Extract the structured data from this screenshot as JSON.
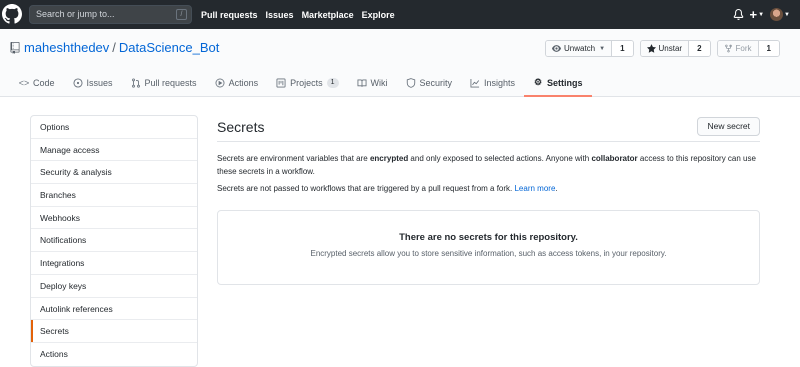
{
  "header": {
    "search_placeholder": "Search or jump to...",
    "search_key": "/",
    "nav": [
      "Pull requests",
      "Issues",
      "Marketplace",
      "Explore"
    ],
    "plus": "+"
  },
  "repo": {
    "owner": "maheshthedev",
    "separator": "/",
    "name": "DataScience_Bot",
    "actions": {
      "watch": {
        "label": "Unwatch",
        "count": "1"
      },
      "star": {
        "label": "Unstar",
        "count": "2"
      },
      "fork": {
        "label": "Fork",
        "count": "1"
      }
    },
    "tabs": [
      {
        "label": "Code",
        "icon": "code-icon"
      },
      {
        "label": "Issues",
        "icon": "issue-icon"
      },
      {
        "label": "Pull requests",
        "icon": "pull-request-icon"
      },
      {
        "label": "Actions",
        "icon": "play-icon"
      },
      {
        "label": "Projects",
        "icon": "project-icon",
        "badge": "1"
      },
      {
        "label": "Wiki",
        "icon": "book-icon"
      },
      {
        "label": "Security",
        "icon": "shield-icon"
      },
      {
        "label": "Insights",
        "icon": "graph-icon"
      },
      {
        "label": "Settings",
        "icon": "gear-icon"
      }
    ]
  },
  "sidebar": {
    "items": [
      {
        "label": "Options"
      },
      {
        "label": "Manage access"
      },
      {
        "label": "Security & analysis"
      },
      {
        "label": "Branches"
      },
      {
        "label": "Webhooks"
      },
      {
        "label": "Notifications"
      },
      {
        "label": "Integrations"
      },
      {
        "label": "Deploy keys"
      },
      {
        "label": "Autolink references"
      },
      {
        "label": "Secrets"
      },
      {
        "label": "Actions"
      }
    ],
    "active": "Secrets"
  },
  "main": {
    "title": "Secrets",
    "new_button": "New secret",
    "desc_part1": "Secrets are environment variables that are ",
    "desc_bold1": "encrypted",
    "desc_part2": " and only exposed to selected actions. Anyone with ",
    "desc_bold2": "collaborator",
    "desc_part3": " access to this repository can use these secrets in a workflow.",
    "desc2_text": "Secrets are not passed to workflows that are triggered by a pull request from a fork. ",
    "desc2_link": "Learn more",
    "desc2_end": ".",
    "empty_title": "There are no secrets for this repository.",
    "empty_text": "Encrypted secrets allow you to store sensitive information, such as access tokens, in your repository."
  },
  "colors": {
    "header_bg": "#24292e",
    "link": "#0366d6",
    "tab_underline": "#f9826c",
    "sidebar_active": "#e36209"
  }
}
